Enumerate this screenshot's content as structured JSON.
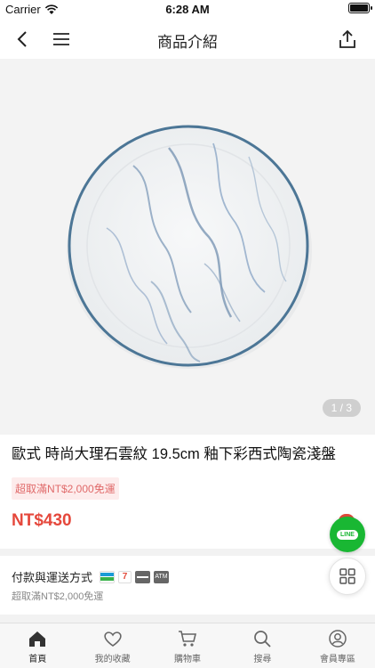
{
  "status_bar": {
    "carrier": "Carrier",
    "time": "6:28 AM"
  },
  "nav": {
    "title": "商品介紹"
  },
  "gallery": {
    "pager": "1 / 3",
    "image": "marble-plate"
  },
  "product": {
    "title": "歐式 時尚大理石雲紋 19.5cm 釉下彩西式陶瓷淺盤",
    "promo": "超取滿NT$2,000免運",
    "price": "NT$430"
  },
  "payment": {
    "label": "付款與運送方式",
    "sub": "超取滿NT$2,000免運",
    "icons": [
      "familymart-icon",
      "seven-eleven-icon",
      "credit-card-icon",
      "atm-icon"
    ]
  },
  "fab": {
    "line_label": "LINE"
  },
  "tabbar": {
    "items": [
      {
        "label": "首頁",
        "icon": "home-icon"
      },
      {
        "label": "我的收藏",
        "icon": "heart-icon"
      },
      {
        "label": "購物車",
        "icon": "cart-icon"
      },
      {
        "label": "搜尋",
        "icon": "search-icon"
      },
      {
        "label": "會員專區",
        "icon": "user-icon"
      }
    ]
  },
  "colors": {
    "price": "#e5483c",
    "promo_bg": "#fdecec",
    "line_green": "#19b733"
  }
}
